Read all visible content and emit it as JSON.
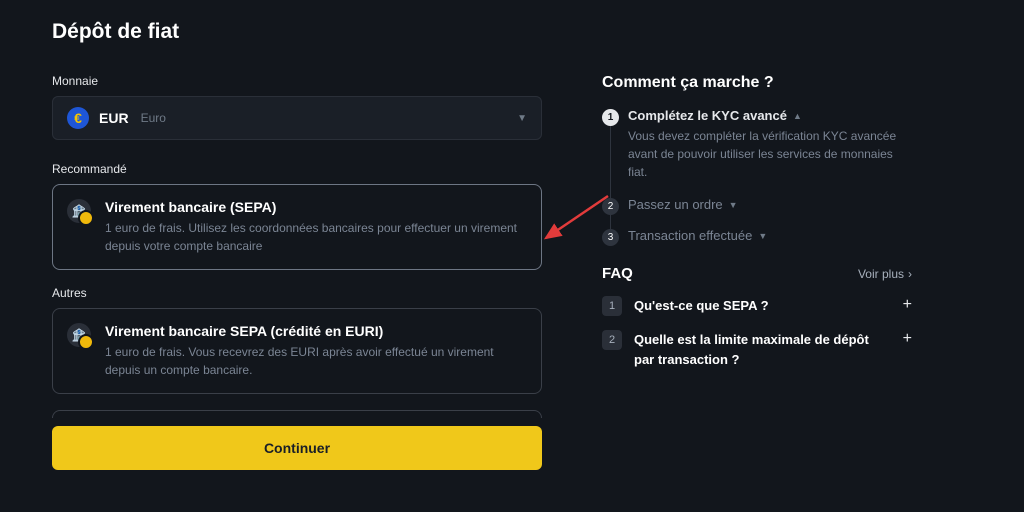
{
  "page": {
    "title": "Dépôt de fiat"
  },
  "currency": {
    "label": "Monnaie",
    "code": "EUR",
    "name": "Euro",
    "icon_name": "euro-icon"
  },
  "recommended": {
    "label": "Recommandé",
    "option": {
      "title": "Virement bancaire (SEPA)",
      "desc": "1 euro de frais. Utilisez les coordonnées bancaires pour effectuer un virement depuis votre compte bancaire",
      "icon_name": "bank-icon"
    }
  },
  "others": {
    "label": "Autres",
    "option": {
      "title": "Virement bancaire SEPA (crédité en EURI)",
      "desc": "1 euro de frais. Vous recevrez des EURI après avoir effectué un virement depuis un compte bancaire.",
      "icon_name": "bank-icon"
    }
  },
  "continue_label": "Continuer",
  "howitworks": {
    "title": "Comment ça marche ?",
    "steps": [
      {
        "num": "1",
        "title": "Complétez le KYC avancé",
        "desc": "Vous devez compléter la vérification KYC avancée avant de pouvoir utiliser les services de monnaies fiat.",
        "expanded": true
      },
      {
        "num": "2",
        "title": "Passez un ordre",
        "expanded": false
      },
      {
        "num": "3",
        "title": "Transaction effectuée",
        "expanded": false
      }
    ]
  },
  "faq": {
    "title": "FAQ",
    "more_label": "Voir plus",
    "items": [
      {
        "num": "1",
        "q": "Qu'est-ce que SEPA ?"
      },
      {
        "num": "2",
        "q": "Quelle est la limite maximale de dépôt par transaction ?"
      }
    ]
  },
  "colors": {
    "accent": "#f0c81a",
    "bg": "#12161c"
  }
}
